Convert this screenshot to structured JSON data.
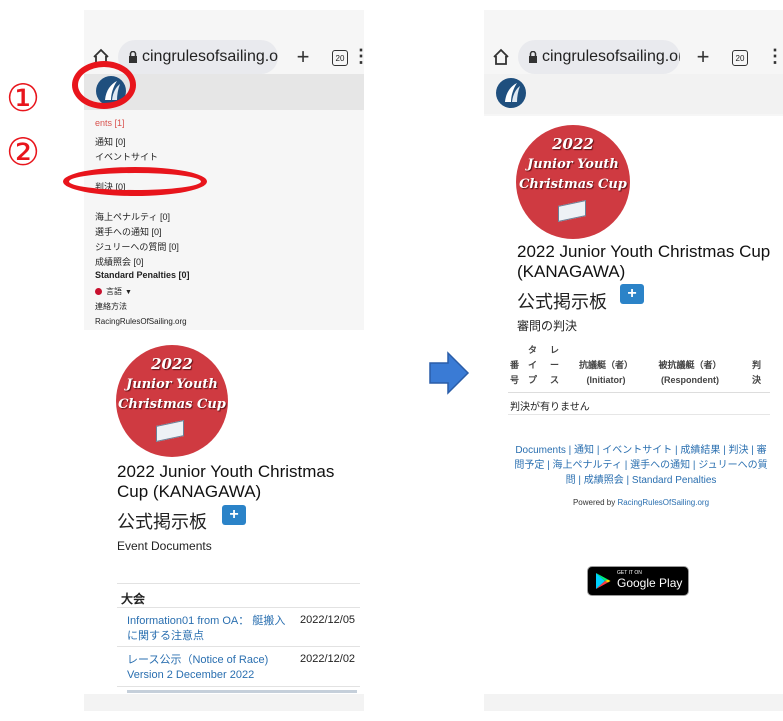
{
  "left_phone": {
    "url": "cingrulesofsailing.org",
    "tab_count": "20",
    "menu": {
      "documents": "ents [1]",
      "notice": "通知 [0]",
      "event_site": "イベントサイト",
      "decisions": "判決 [0]",
      "on_water_penalty": "海上ペナルティ [0]",
      "notice_to_competitors": "選手への通知 [0]",
      "questions_to_jury": "ジュリーへの質問 [0]",
      "results_inquiry": "成績照会 [0]",
      "standard_penalties": "Standard Penalties [0]",
      "language": "言語",
      "contact": "連絡方法",
      "site": "RacingRulesOfSailing.org"
    },
    "badge": {
      "year": "2022",
      "line1": "Junior Youth",
      "line2": "Christmas Cup"
    },
    "event_title": "2022 Junior Youth Christmas Cup (KANAGAWA)",
    "board_title": "公式掲示板",
    "section": "Event Documents",
    "table_heading": "大会",
    "documents": [
      {
        "name": "Information01 from OA： 艇搬入に関する注意点",
        "date": "2022/12/05"
      },
      {
        "name": "レース公示（Notice of Race) Version 2 December 2022",
        "date": "2022/12/02"
      }
    ],
    "callout_1": "①",
    "callout_2": "②"
  },
  "right_phone": {
    "url": "cingrulesofsailing.org",
    "tab_count": "20",
    "badge": {
      "year": "2022",
      "line1": "Junior Youth",
      "line2": "Christmas Cup"
    },
    "event_title": "2022 Junior Youth Christmas Cup (KANAGAWA)",
    "board_title": "公式掲示板",
    "subtitle": "審問の判決",
    "columns": {
      "num": "番号",
      "type": "タイプ",
      "race": "レース",
      "initiator": "抗議艇（者）",
      "initiator_en": "(Initiator)",
      "respondent": "被抗議艇（者）",
      "respondent_en": "(Respondent)",
      "decision": "判決"
    },
    "empty_message": "判決が有りません",
    "footer_links": "Documents | 通知 | イベントサイト | 成績結果 | 判決 | 審問予定 | 海上ペナルティ | 選手への通知 | ジュリーへの質問 | 成績照会 | Standard Penalties",
    "powered_by": "Powered by",
    "powered_link": "RacingRulesOfSailing.org",
    "gp_small": "GET IT ON",
    "gp_big": "Google Play"
  },
  "colors": {
    "callout_red": "#e8151c",
    "link_blue": "#2a6fb0",
    "badge_red": "#cf3a41",
    "arrow_blue": "#3a7bd5"
  }
}
